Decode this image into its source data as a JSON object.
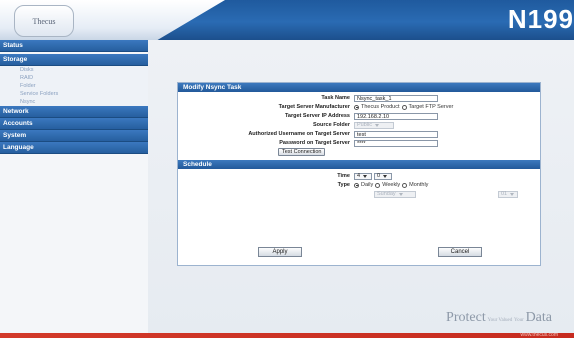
{
  "header": {
    "logo_text": "Thecus",
    "model": "N199"
  },
  "sidebar": {
    "items": [
      {
        "label": "Status"
      },
      {
        "label": "Storage",
        "sub": [
          "Disks",
          "RAID",
          "Folder",
          "Service Folders",
          "Nsync"
        ]
      },
      {
        "label": "Network"
      },
      {
        "label": "Accounts"
      },
      {
        "label": "System"
      },
      {
        "label": "Language"
      }
    ]
  },
  "modify": {
    "title": "Modify Nsync Task",
    "task_name": {
      "label": "Task Name",
      "value": "Nsync_task_1"
    },
    "manufacturer": {
      "label": "Target Server Manufacturer",
      "opt1": "Thecus Product",
      "opt2": "Target FTP Server"
    },
    "ip": {
      "label": "Target Server IP Address",
      "value": "192.168.2.10"
    },
    "source": {
      "label": "Source Folder",
      "value": "Public"
    },
    "username": {
      "label": "Authorized Username on Target Server",
      "value": "test"
    },
    "password": {
      "label": "Password on Target Server",
      "value": "****"
    },
    "test_button": "Test Connection"
  },
  "schedule": {
    "title": "Schedule",
    "time": {
      "label": "Time",
      "hour": "4",
      "minute": "0"
    },
    "type": {
      "label": "Type",
      "daily": "Daily",
      "weekly": "Weekly",
      "monthly": "Monthly",
      "day_select": "Sunday",
      "date_select": "01"
    }
  },
  "buttons": {
    "apply": "Apply",
    "cancel": "Cancel"
  },
  "branding": {
    "tagline_1": "Protect",
    "tagline_small_1": "Your Valued",
    "tagline_small_2": "Your",
    "tagline_2": "Data",
    "url": "www.thecus.com"
  }
}
